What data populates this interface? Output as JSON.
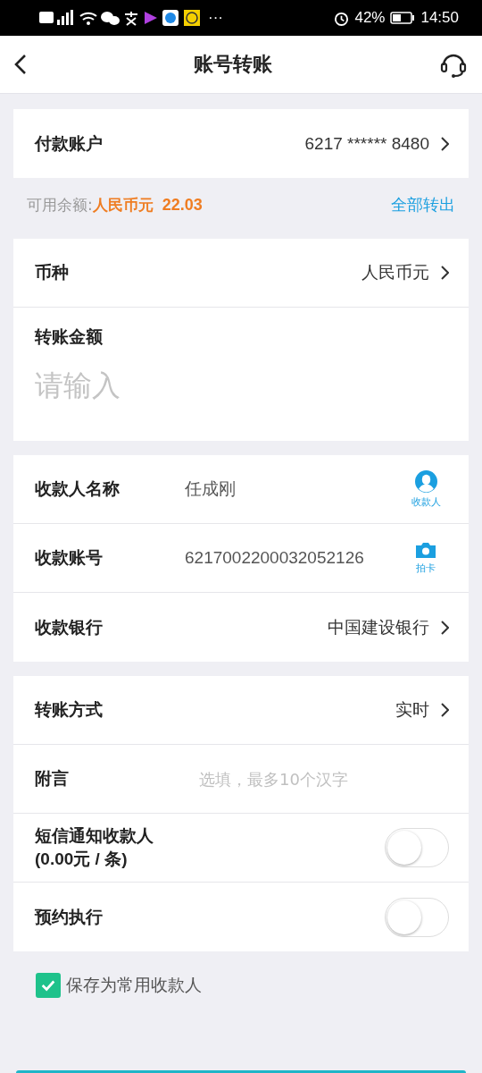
{
  "status_bar": {
    "more": "···",
    "battery": "42%",
    "time": "14:50"
  },
  "header": {
    "title": "账号转账"
  },
  "payer": {
    "label": "付款账户",
    "value": "6217 ****** 8480"
  },
  "balance": {
    "label": "可用余额:",
    "currency": "人民币元",
    "amount": "22.03",
    "action": "全部转出"
  },
  "sections": [
    {
      "rows": [
        {
          "kind": "link",
          "label": "币种",
          "value": "人民币元"
        },
        {
          "kind": "amount",
          "label": "转账金额",
          "placeholder": "请输入"
        }
      ]
    },
    {
      "rows": [
        {
          "kind": "payee",
          "label": "收款人名称",
          "value": "任成刚",
          "caption": "收款人"
        },
        {
          "kind": "card",
          "label": "收款账号",
          "value": "6217002200032052126",
          "caption": "拍卡"
        },
        {
          "kind": "link",
          "label": "收款银行",
          "value": "中国建设银行"
        }
      ]
    },
    {
      "rows": [
        {
          "kind": "link",
          "label": "转账方式",
          "value": "实时"
        },
        {
          "kind": "input",
          "label": "附言",
          "placeholder": "选填，最多10个汉字"
        },
        {
          "kind": "toggle",
          "label": "短信通知收款人",
          "sublabel": "(0.00元 / 条)",
          "on": false
        },
        {
          "kind": "toggle",
          "label": "预约执行",
          "on": false
        }
      ]
    }
  ],
  "save_payee": {
    "label": "保存为常用收款人",
    "checked": true
  }
}
